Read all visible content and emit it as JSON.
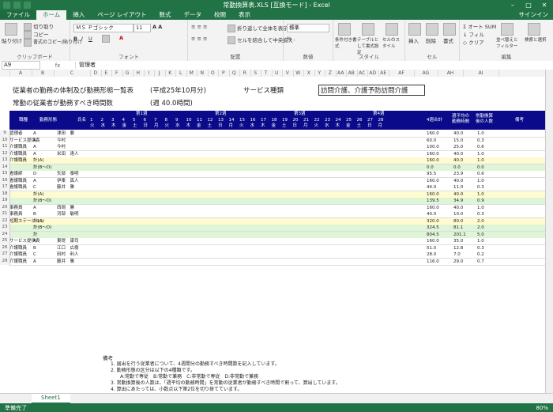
{
  "window": {
    "title": "常勤換算表.XLS [互換モード] - Excel",
    "min": "–",
    "max": "□",
    "close": "✕"
  },
  "tabs": [
    "ファイル",
    "ホーム",
    "挿入",
    "ページ レイアウト",
    "数式",
    "データ",
    "校閲",
    "表示"
  ],
  "signin": "サインイン",
  "ribbon": {
    "paste": "貼り付け",
    "cut": "切り取り",
    "copy": "コピー",
    "format_painter": "書式のコピー/貼り付け",
    "clipboard": "クリップボード",
    "font_name": "ＭＳ Ｐゴシック",
    "font_size": "11",
    "font": "フォント",
    "wrap": "折り返して全体を表示する",
    "merge": "セルを結合して中央揃え",
    "alignment": "配置",
    "number_format": "標準",
    "number": "数値",
    "cond_format": "条件付き書式",
    "table_format": "テーブルとして書式設定",
    "cell_style": "セルのスタイル",
    "style": "スタイル",
    "insert": "挿入",
    "delete": "削除",
    "format": "書式",
    "cells": "セル",
    "autosum": "オート SUM",
    "fill": "フィル",
    "clear": "クリア",
    "sort": "並べ替えとフィルター",
    "find": "検索と選択",
    "editing": "編集"
  },
  "formula_bar": {
    "cell": "A9",
    "fx": "fx",
    "value": "管理者"
  },
  "columns": [
    "A",
    "B",
    "C",
    "D",
    "E",
    "F",
    "G",
    "H",
    "I",
    "J",
    "K",
    "L",
    "M",
    "N",
    "O",
    "P",
    "Q",
    "R",
    "S",
    "T",
    "U",
    "V",
    "W",
    "X",
    "Y",
    "Z",
    "AA",
    "AB",
    "AC",
    "AD",
    "AE",
    "AF",
    "AG",
    "AH",
    "AI"
  ],
  "sheet": {
    "line1": "従業者の勤務の体制及び勤務形態一覧表",
    "period": "(平成25年10月分)",
    "svc_label": "サービス種類",
    "svc_value": "訪問介護、介護予防訪問介護",
    "line2": "常勤の従業者が勤務すべき時間数",
    "hours": "(週 40.0時間)",
    "hdr_job": "職種",
    "hdr_form": "勤務形態",
    "hdr_name": "氏名",
    "weeks": [
      "第1週",
      "第2週",
      "第3週",
      "第4週"
    ],
    "hdr_total": "4週合計",
    "hdr_avg": "週平均の勤務時間",
    "hdr_conv": "常勤換算後の人数",
    "hdr_note": "備考",
    "days": [
      "1",
      "2",
      "3",
      "4",
      "5",
      "6",
      "7",
      "8",
      "9",
      "10",
      "11",
      "12",
      "13",
      "14",
      "15",
      "16",
      "17",
      "18",
      "19",
      "20",
      "21",
      "22",
      "23",
      "24",
      "25",
      "26",
      "27",
      "28"
    ],
    "dows": [
      "火",
      "水",
      "木",
      "金",
      "土",
      "日",
      "月",
      "火",
      "水",
      "木",
      "金",
      "土",
      "日",
      "月",
      "火",
      "水",
      "木",
      "金",
      "土",
      "日",
      "月",
      "火",
      "水",
      "木",
      "金",
      "土",
      "日",
      "月"
    ]
  },
  "rows": [
    {
      "n": "9",
      "job": "管理者",
      "form": "A",
      "name": "津田　要",
      "total": "160.0",
      "avg": "40.0",
      "conv": "1.0"
    },
    {
      "n": "10",
      "job": "サービス提供責",
      "form": "A",
      "name": "今村",
      "total": "60.0",
      "avg": "15.0",
      "conv": "0.3"
    },
    {
      "n": "11",
      "job": "介護職員",
      "form": "A",
      "name": "今村",
      "total": "100.0",
      "avg": "25.0",
      "conv": "0.6"
    },
    {
      "n": "12",
      "job": "介護職員",
      "form": "A",
      "name": "米田　達人",
      "total": "160.0",
      "avg": "40.0",
      "conv": "1.0"
    },
    {
      "n": "13",
      "job": "介護職員",
      "form": "計(A)",
      "name": "",
      "total": "160.0",
      "avg": "40.0",
      "conv": "1.0"
    },
    {
      "n": "14",
      "job": "",
      "form": "計(B〜D)",
      "name": "",
      "total": "0.0",
      "avg": "0.0",
      "conv": "0.0"
    },
    {
      "n": "15",
      "job": "看護師",
      "form": "D",
      "name": "矢部　泰明",
      "total": "95.5",
      "avg": "23.9",
      "conv": "0.6"
    },
    {
      "n": "16",
      "job": "看護職員",
      "form": "A",
      "name": "伊東　真人",
      "total": "160.0",
      "avg": "40.0",
      "conv": "1.0"
    },
    {
      "n": "17",
      "job": "看護職員",
      "form": "C",
      "name": "藤井　雅",
      "total": "44.0",
      "avg": "11.0",
      "conv": "0.3"
    },
    {
      "n": "18",
      "job": "",
      "form": "計(A)",
      "name": "",
      "total": "160.0",
      "avg": "40.0",
      "conv": "1.0"
    },
    {
      "n": "19",
      "job": "",
      "form": "計(B〜D)",
      "name": "",
      "total": "139.5",
      "avg": "34.9",
      "conv": "0.9"
    },
    {
      "n": "20",
      "job": "事務員",
      "form": "A",
      "name": "西岡　勝",
      "total": "160.0",
      "avg": "40.0",
      "conv": "1.0"
    },
    {
      "n": "21",
      "job": "事務員",
      "form": "B",
      "name": "河部　敏明",
      "total": "40.0",
      "avg": "10.0",
      "conv": "0.3"
    },
    {
      "n": "22",
      "job": "短期ステーション",
      "form": "計(A)",
      "name": "",
      "total": "320.0",
      "avg": "80.0",
      "conv": "2.0"
    },
    {
      "n": "23",
      "job": "",
      "form": "計(B〜D)",
      "name": "",
      "total": "324.5",
      "avg": "81.1",
      "conv": "2.0"
    },
    {
      "n": "24",
      "job": "",
      "form": "計",
      "name": "",
      "total": "804.5",
      "avg": "201.1",
      "conv": "5.0"
    },
    {
      "n": "25",
      "job": "サービス提供責",
      "form": "A",
      "name": "東堤　康司",
      "total": "160.0",
      "avg": "35.0",
      "conv": "1.0"
    },
    {
      "n": "26",
      "job": "介護職員",
      "form": "B",
      "name": "江口　広樹",
      "total": "51.0",
      "avg": "12.8",
      "conv": "0.3"
    },
    {
      "n": "27",
      "job": "介護職員",
      "form": "C",
      "name": "田村　利人",
      "total": "28.0",
      "avg": "7.0",
      "conv": "0.2"
    },
    {
      "n": "28",
      "job": "介護職員",
      "form": "A",
      "name": "藤井　雅",
      "total": "116.0",
      "avg": "29.0",
      "conv": "0.7"
    }
  ],
  "notes": {
    "title": "備考",
    "lines": [
      "1. 届出を行う従業者について、4週間分の勤務すべき時間数を記入しています。",
      "2. 勤務形態の区分は以下の4種類です。",
      "　　A:常勤で専従　B:常勤で兼務　C:非常勤で専従　D:非常勤で兼務",
      "3. 常勤換算後の人数は、「週平均の勤務時間」を常勤の従業者が勤務すべき時間で割って、算出しています。",
      "4. 算出にあたっては、小数点以下第2位を切り捨てています。"
    ]
  },
  "sheet_tab": "Sheet1",
  "status": {
    "ready": "準備完了",
    "zoom": "80%"
  },
  "colors": {
    "excel_green": "#217346",
    "header_navy": "#0a0a8a",
    "row_yellow": "#fffbd0",
    "row_green": "#dff5d7",
    "row_cyan": "#d5f5fb"
  }
}
